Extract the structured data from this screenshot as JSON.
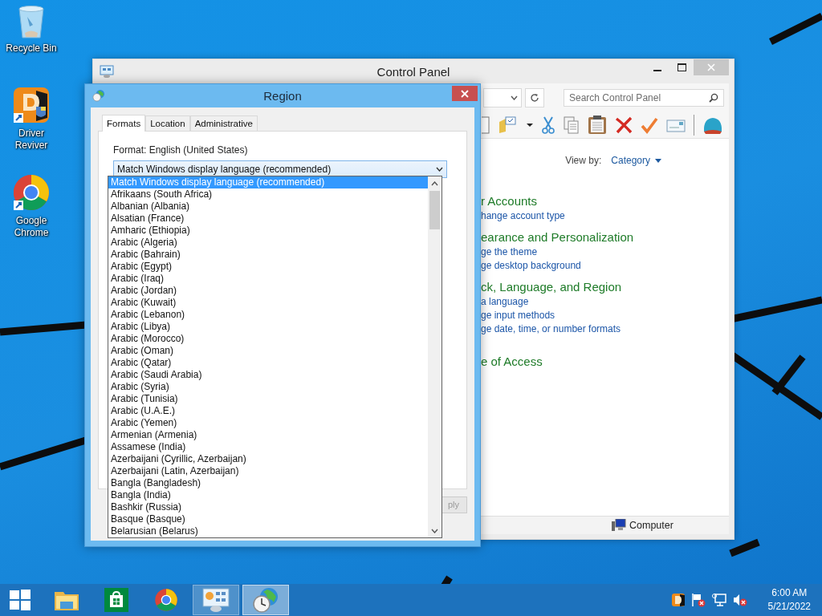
{
  "desktop_icons": [
    {
      "kind": "recycle",
      "label": "Recycle Bin"
    },
    {
      "kind": "driver",
      "label": "Driver Reviver"
    },
    {
      "kind": "chrome",
      "label": "Google Chrome"
    }
  ],
  "control_panel": {
    "title": "Control Panel",
    "search": {
      "placeholder": "Search Control Panel"
    },
    "view_by": {
      "label": "View by:",
      "value": "Category"
    },
    "categories": [
      {
        "heading": "r Accounts",
        "links": [
          "hange account type"
        ]
      },
      {
        "heading": "earance and Personalization",
        "links": [
          "ge the theme",
          "ge desktop background"
        ]
      },
      {
        "heading": "ck, Language, and Region",
        "links": [
          "a language",
          "ge input methods",
          "ge date, time, or number formats"
        ]
      },
      {
        "heading": "e of Access"
      }
    ],
    "status_bar": "Computer"
  },
  "region": {
    "title": "Region",
    "tabs": [
      {
        "label": "Formats",
        "selected": true
      },
      {
        "label": "Location",
        "selected": false
      },
      {
        "label": "Administrative",
        "selected": false
      }
    ],
    "format_label": "Format: English (United States)",
    "combo_value": "Match Windows display language (recommended)",
    "list_items": [
      {
        "label": "Match Windows display language (recommended)",
        "selected": true
      },
      {
        "label": "Afrikaans (South Africa)",
        "selected": false
      },
      {
        "label": "Albanian (Albania)",
        "selected": false
      },
      {
        "label": "Alsatian (France)",
        "selected": false
      },
      {
        "label": "Amharic (Ethiopia)",
        "selected": false
      },
      {
        "label": "Arabic (Algeria)",
        "selected": false
      },
      {
        "label": "Arabic (Bahrain)",
        "selected": false
      },
      {
        "label": "Arabic (Egypt)",
        "selected": false
      },
      {
        "label": "Arabic (Iraq)",
        "selected": false
      },
      {
        "label": "Arabic (Jordan)",
        "selected": false
      },
      {
        "label": "Arabic (Kuwait)",
        "selected": false
      },
      {
        "label": "Arabic (Lebanon)",
        "selected": false
      },
      {
        "label": "Arabic (Libya)",
        "selected": false
      },
      {
        "label": "Arabic (Morocco)",
        "selected": false
      },
      {
        "label": "Arabic (Oman)",
        "selected": false
      },
      {
        "label": "Arabic (Qatar)",
        "selected": false
      },
      {
        "label": "Arabic (Saudi Arabia)",
        "selected": false
      },
      {
        "label": "Arabic (Syria)",
        "selected": false
      },
      {
        "label": "Arabic (Tunisia)",
        "selected": false
      },
      {
        "label": "Arabic (U.A.E.)",
        "selected": false
      },
      {
        "label": "Arabic (Yemen)",
        "selected": false
      },
      {
        "label": "Armenian (Armenia)",
        "selected": false
      },
      {
        "label": "Assamese (India)",
        "selected": false
      },
      {
        "label": "Azerbaijani (Cyrillic, Azerbaijan)",
        "selected": false
      },
      {
        "label": "Azerbaijani (Latin, Azerbaijan)",
        "selected": false
      },
      {
        "label": "Bangla (Bangladesh)",
        "selected": false
      },
      {
        "label": "Bangla (India)",
        "selected": false
      },
      {
        "label": "Bashkir (Russia)",
        "selected": false
      },
      {
        "label": "Basque (Basque)",
        "selected": false
      },
      {
        "label": "Belarusian (Belarus)",
        "selected": false
      }
    ],
    "button_label": "ply"
  },
  "taskbar": {
    "apps": [
      {
        "kind": "explorer",
        "running": false,
        "selected": false
      },
      {
        "kind": "store",
        "running": false,
        "selected": false
      },
      {
        "kind": "chrome",
        "running": false,
        "selected": false
      },
      {
        "kind": "controlpanel",
        "running": true,
        "selected": false
      },
      {
        "kind": "region",
        "running": true,
        "selected": true
      }
    ],
    "time": "6:00 AM",
    "date": "5/21/2022"
  }
}
